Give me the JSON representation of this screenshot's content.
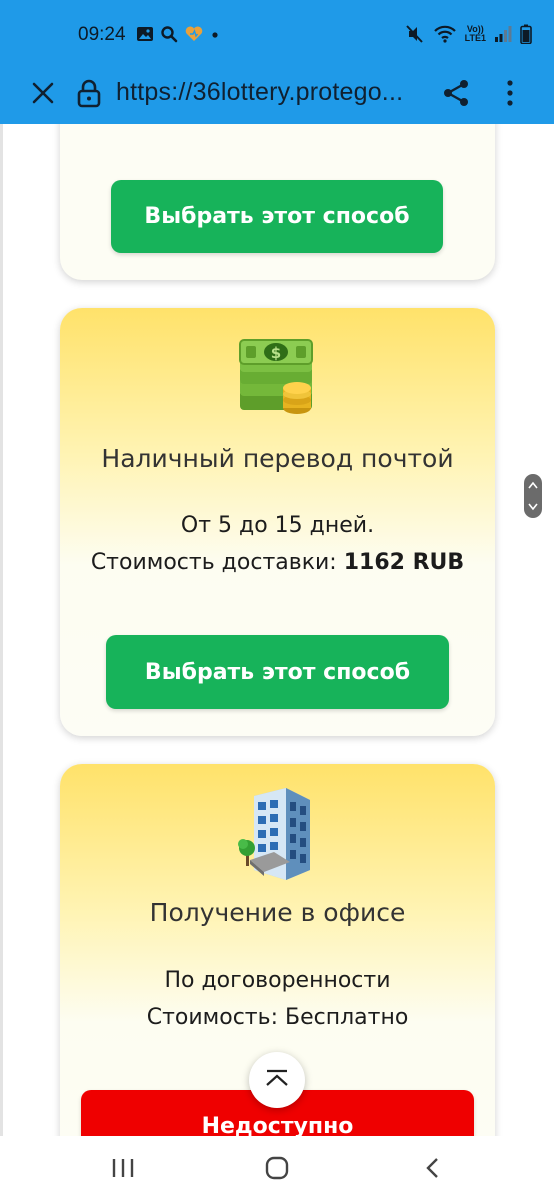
{
  "status_bar": {
    "time": "09:24",
    "left_icons": [
      "gallery-icon",
      "search-icon",
      "heart-icon",
      "dot-icon"
    ],
    "right_icons": [
      "mute-icon",
      "wifi-icon",
      "volte-icon",
      "signal-icon",
      "battery-icon"
    ],
    "network_label_top": "Vo))",
    "network_label_bottom": "LTE1"
  },
  "browser": {
    "url": "https://36lottery.protego..."
  },
  "cards": [
    {
      "button_label": "Выбрать этот способ"
    },
    {
      "icon": "money-stack-icon",
      "title": "Наличный перевод почтой",
      "line1": "От 5 до 15 дней.",
      "line2_label": "Стоимость доставки:",
      "line2_value": "1162 RUB",
      "button_label": "Выбрать этот способ"
    },
    {
      "icon": "office-building-icon",
      "title": "Получение в офисе",
      "line1": "По договоренности",
      "line2": "Стоимость: Бесплатно",
      "button_label": "Недоступно"
    }
  ],
  "colors": {
    "toolbar": "#1f9ae8",
    "button_green": "#17b35a",
    "button_red": "#ef0000",
    "card_gradient_top": "#ffe26a"
  },
  "navbar": {
    "buttons": [
      "recent-apps-icon",
      "home-icon",
      "back-icon"
    ]
  }
}
